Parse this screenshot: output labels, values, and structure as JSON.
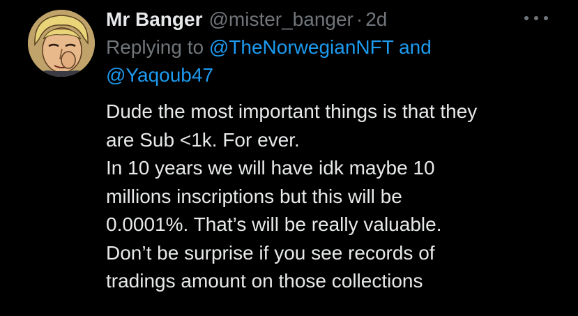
{
  "tweet": {
    "display_name": "Mr Banger",
    "handle": "@mister_banger",
    "separator": "·",
    "time": "2d",
    "more_icon": "more-horizontal-icon",
    "replying_to_prefix": "Replying to",
    "mention_1": "@TheNorwegianNFT",
    "and_word": "and",
    "mention_2": "@Yaqoub47",
    "body_lines": [
      "Dude the most important things is that they",
      "are Sub <1k. For ever.",
      "In 10 years we will have idk maybe 10",
      "millions inscriptions but this will be",
      "0.0001%. That’s will be really valuable.",
      "Don’t be surprise if you see records of",
      "tradings amount on those collections"
    ]
  },
  "colors": {
    "background": "#000000",
    "text": "#e7e9ea",
    "muted": "#71767b",
    "link": "#1d9bf0"
  }
}
